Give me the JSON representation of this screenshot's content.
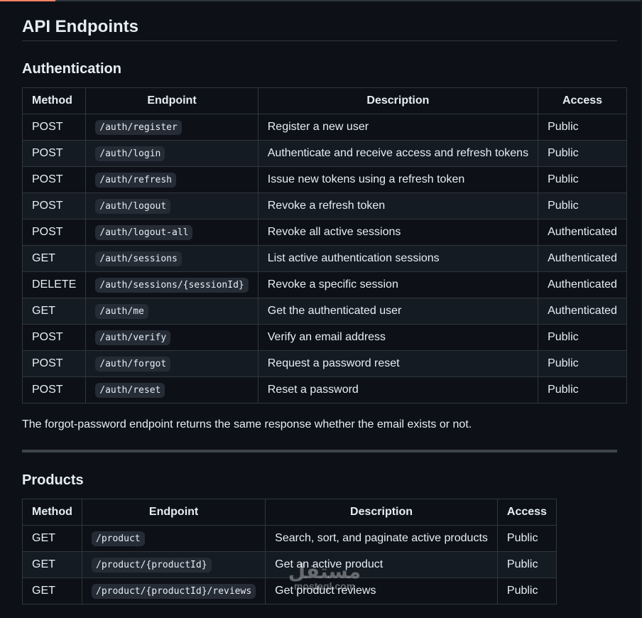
{
  "page_title": "API Endpoints",
  "sections": {
    "auth": {
      "title": "Authentication",
      "headers": [
        "Method",
        "Endpoint",
        "Description",
        "Access"
      ],
      "rows": [
        {
          "method": "POST",
          "endpoint": "/auth/register",
          "description": "Register a new user",
          "access": "Public"
        },
        {
          "method": "POST",
          "endpoint": "/auth/login",
          "description": "Authenticate and receive access and refresh tokens",
          "access": "Public"
        },
        {
          "method": "POST",
          "endpoint": "/auth/refresh",
          "description": "Issue new tokens using a refresh token",
          "access": "Public"
        },
        {
          "method": "POST",
          "endpoint": "/auth/logout",
          "description": "Revoke a refresh token",
          "access": "Public"
        },
        {
          "method": "POST",
          "endpoint": "/auth/logout-all",
          "description": "Revoke all active sessions",
          "access": "Authenticated"
        },
        {
          "method": "GET",
          "endpoint": "/auth/sessions",
          "description": "List active authentication sessions",
          "access": "Authenticated"
        },
        {
          "method": "DELETE",
          "endpoint": "/auth/sessions/{sessionId}",
          "description": "Revoke a specific session",
          "access": "Authenticated"
        },
        {
          "method": "GET",
          "endpoint": "/auth/me",
          "description": "Get the authenticated user",
          "access": "Authenticated"
        },
        {
          "method": "POST",
          "endpoint": "/auth/verify",
          "description": "Verify an email address",
          "access": "Public"
        },
        {
          "method": "POST",
          "endpoint": "/auth/forgot",
          "description": "Request a password reset",
          "access": "Public"
        },
        {
          "method": "POST",
          "endpoint": "/auth/reset",
          "description": "Reset a password",
          "access": "Public"
        }
      ],
      "note": "The forgot-password endpoint returns the same response whether the email exists or not."
    },
    "products": {
      "title": "Products",
      "headers": [
        "Method",
        "Endpoint",
        "Description",
        "Access"
      ],
      "rows": [
        {
          "method": "GET",
          "endpoint": "/product",
          "description": "Search, sort, and paginate active products",
          "access": "Public"
        },
        {
          "method": "GET",
          "endpoint": "/product/{productId}",
          "description": "Get an active product",
          "access": "Public"
        },
        {
          "method": "GET",
          "endpoint": "/product/{productId}/reviews",
          "description": "Get product reviews",
          "access": "Public"
        }
      ]
    }
  },
  "watermark": {
    "arabic": "مستقل",
    "latin": "mostaql.com"
  },
  "colors": {
    "background": "#0d1117",
    "text": "#e6edf3",
    "border": "#30363d",
    "row_alt": "#151b23",
    "code_bg": "#262c36",
    "accent": "#f78166"
  }
}
